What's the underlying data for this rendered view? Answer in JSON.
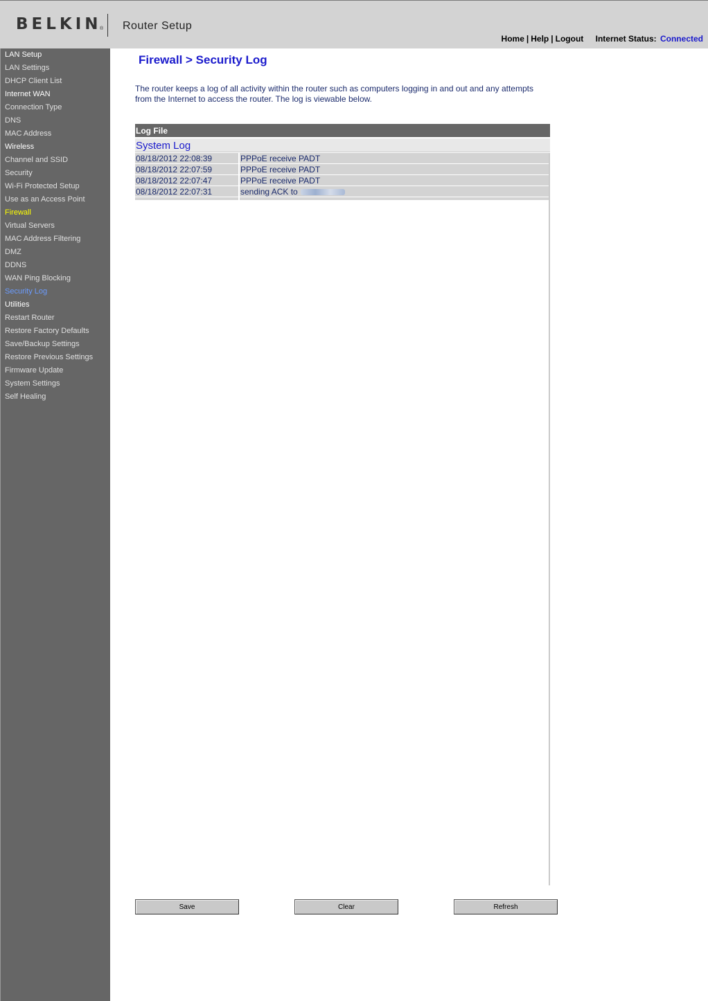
{
  "header": {
    "brand": "BELKIN",
    "brand_mark": "®",
    "title": "Router Setup",
    "links": [
      "Home",
      "Help",
      "Logout"
    ],
    "link_separator": "|",
    "status_label": "Internet Status:",
    "status_value": "Connected",
    "status_color": "#1a1acc"
  },
  "sidebar": {
    "items": [
      {
        "label": "LAN Setup",
        "kind": "section"
      },
      {
        "label": "LAN Settings",
        "kind": "link"
      },
      {
        "label": "DHCP Client List",
        "kind": "link"
      },
      {
        "label": "Internet WAN",
        "kind": "section"
      },
      {
        "label": "Connection Type",
        "kind": "link"
      },
      {
        "label": "DNS",
        "kind": "link"
      },
      {
        "label": "MAC Address",
        "kind": "link"
      },
      {
        "label": "Wireless",
        "kind": "section"
      },
      {
        "label": "Channel and SSID",
        "kind": "link"
      },
      {
        "label": "Security",
        "kind": "link"
      },
      {
        "label": "Wi-Fi Protected Setup",
        "kind": "link"
      },
      {
        "label": "Use as an Access Point",
        "kind": "link"
      },
      {
        "label": "Firewall",
        "kind": "section-current"
      },
      {
        "label": "Virtual Servers",
        "kind": "link"
      },
      {
        "label": "MAC Address Filtering",
        "kind": "link"
      },
      {
        "label": "DMZ",
        "kind": "link"
      },
      {
        "label": "DDNS",
        "kind": "link"
      },
      {
        "label": "WAN Ping Blocking",
        "kind": "link"
      },
      {
        "label": "Security Log",
        "kind": "active"
      },
      {
        "label": "Utilities",
        "kind": "section"
      },
      {
        "label": "Restart Router",
        "kind": "link"
      },
      {
        "label": "Restore Factory Defaults",
        "kind": "link"
      },
      {
        "label": "Save/Backup Settings",
        "kind": "link"
      },
      {
        "label": "Restore Previous Settings",
        "kind": "link"
      },
      {
        "label": "Firmware Update",
        "kind": "link"
      },
      {
        "label": "System Settings",
        "kind": "link"
      },
      {
        "label": "Self Healing",
        "kind": "link"
      }
    ],
    "colors": {
      "section": "#ffffff",
      "link": "#e0e0e0",
      "current": "#ffff00",
      "active": "#6b9cff"
    }
  },
  "main": {
    "title": "Firewall > Security Log",
    "intro": "The router keeps a log of all activity within the router such as computers logging in and out and any attempts from the Internet to access the router. The log is viewable below.",
    "log_file_label": "Log File",
    "system_log_label": "System Log",
    "log_entries": [
      {
        "date": "08/18/2012 22:08:39",
        "message": "PPPoE receive PADT"
      },
      {
        "date": "08/18/2012 22:07:59",
        "message": "PPPoE receive PADT"
      },
      {
        "date": "08/18/2012 22:07:47",
        "message": "PPPoE receive PADT"
      },
      {
        "date": "08/18/2012 22:07:31",
        "message": "sending ACK to",
        "redacted": true
      }
    ]
  },
  "buttons": {
    "save": "Save",
    "clear": "Clear",
    "refresh": "Refresh"
  }
}
